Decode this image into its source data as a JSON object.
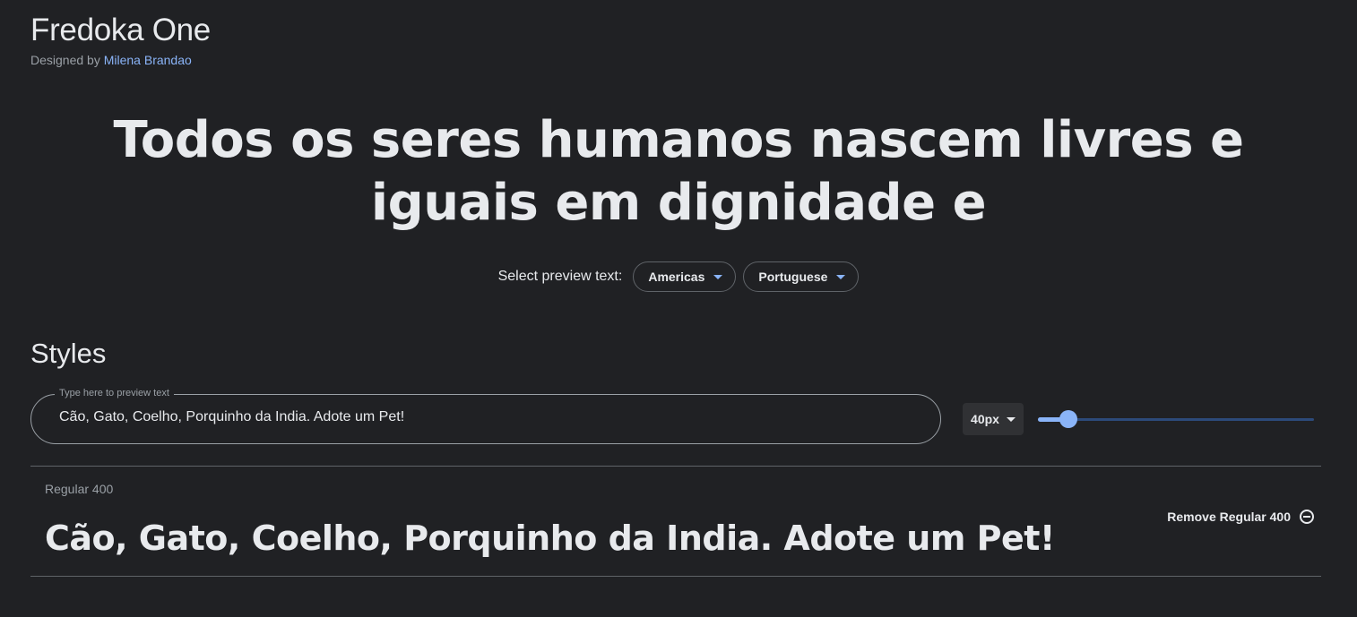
{
  "header": {
    "title": "Fredoka One",
    "designed_by_prefix": "Designed by",
    "designer_name": "Milena Brandao"
  },
  "hero": {
    "text": "Todos os seres humanos nascem livres e iguais em dignidade e"
  },
  "preview_select": {
    "label": "Select preview text:",
    "region": "Americas",
    "language": "Portuguese"
  },
  "styles": {
    "heading": "Styles",
    "input": {
      "legend": "Type here to preview text",
      "value": "Cão, Gato, Coelho, Porquinho da India. Adote um Pet!"
    },
    "size": {
      "value": "40px",
      "slider_fraction": 0.11
    },
    "items": [
      {
        "name": "Regular 400",
        "sample": "Cão, Gato, Coelho, Porquinho da India. Adote um Pet!",
        "remove_label": "Remove Regular 400"
      }
    ]
  },
  "colors": {
    "background": "#202124",
    "accent": "#8ab4f8",
    "text": "#e8eaed",
    "muted": "#9aa0a6"
  }
}
